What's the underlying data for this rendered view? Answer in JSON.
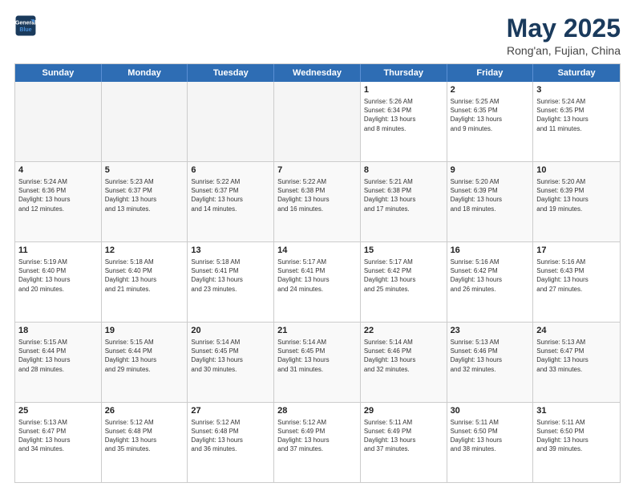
{
  "logo": {
    "line1": "General",
    "line2": "Blue"
  },
  "title": {
    "month": "May 2025",
    "location": "Rong'an, Fujian, China"
  },
  "weekdays": [
    "Sunday",
    "Monday",
    "Tuesday",
    "Wednesday",
    "Thursday",
    "Friday",
    "Saturday"
  ],
  "weeks": [
    [
      {
        "day": "",
        "info": ""
      },
      {
        "day": "",
        "info": ""
      },
      {
        "day": "",
        "info": ""
      },
      {
        "day": "",
        "info": ""
      },
      {
        "day": "1",
        "info": "Sunrise: 5:26 AM\nSunset: 6:34 PM\nDaylight: 13 hours\nand 8 minutes."
      },
      {
        "day": "2",
        "info": "Sunrise: 5:25 AM\nSunset: 6:35 PM\nDaylight: 13 hours\nand 9 minutes."
      },
      {
        "day": "3",
        "info": "Sunrise: 5:24 AM\nSunset: 6:35 PM\nDaylight: 13 hours\nand 11 minutes."
      }
    ],
    [
      {
        "day": "4",
        "info": "Sunrise: 5:24 AM\nSunset: 6:36 PM\nDaylight: 13 hours\nand 12 minutes."
      },
      {
        "day": "5",
        "info": "Sunrise: 5:23 AM\nSunset: 6:37 PM\nDaylight: 13 hours\nand 13 minutes."
      },
      {
        "day": "6",
        "info": "Sunrise: 5:22 AM\nSunset: 6:37 PM\nDaylight: 13 hours\nand 14 minutes."
      },
      {
        "day": "7",
        "info": "Sunrise: 5:22 AM\nSunset: 6:38 PM\nDaylight: 13 hours\nand 16 minutes."
      },
      {
        "day": "8",
        "info": "Sunrise: 5:21 AM\nSunset: 6:38 PM\nDaylight: 13 hours\nand 17 minutes."
      },
      {
        "day": "9",
        "info": "Sunrise: 5:20 AM\nSunset: 6:39 PM\nDaylight: 13 hours\nand 18 minutes."
      },
      {
        "day": "10",
        "info": "Sunrise: 5:20 AM\nSunset: 6:39 PM\nDaylight: 13 hours\nand 19 minutes."
      }
    ],
    [
      {
        "day": "11",
        "info": "Sunrise: 5:19 AM\nSunset: 6:40 PM\nDaylight: 13 hours\nand 20 minutes."
      },
      {
        "day": "12",
        "info": "Sunrise: 5:18 AM\nSunset: 6:40 PM\nDaylight: 13 hours\nand 21 minutes."
      },
      {
        "day": "13",
        "info": "Sunrise: 5:18 AM\nSunset: 6:41 PM\nDaylight: 13 hours\nand 23 minutes."
      },
      {
        "day": "14",
        "info": "Sunrise: 5:17 AM\nSunset: 6:41 PM\nDaylight: 13 hours\nand 24 minutes."
      },
      {
        "day": "15",
        "info": "Sunrise: 5:17 AM\nSunset: 6:42 PM\nDaylight: 13 hours\nand 25 minutes."
      },
      {
        "day": "16",
        "info": "Sunrise: 5:16 AM\nSunset: 6:42 PM\nDaylight: 13 hours\nand 26 minutes."
      },
      {
        "day": "17",
        "info": "Sunrise: 5:16 AM\nSunset: 6:43 PM\nDaylight: 13 hours\nand 27 minutes."
      }
    ],
    [
      {
        "day": "18",
        "info": "Sunrise: 5:15 AM\nSunset: 6:44 PM\nDaylight: 13 hours\nand 28 minutes."
      },
      {
        "day": "19",
        "info": "Sunrise: 5:15 AM\nSunset: 6:44 PM\nDaylight: 13 hours\nand 29 minutes."
      },
      {
        "day": "20",
        "info": "Sunrise: 5:14 AM\nSunset: 6:45 PM\nDaylight: 13 hours\nand 30 minutes."
      },
      {
        "day": "21",
        "info": "Sunrise: 5:14 AM\nSunset: 6:45 PM\nDaylight: 13 hours\nand 31 minutes."
      },
      {
        "day": "22",
        "info": "Sunrise: 5:14 AM\nSunset: 6:46 PM\nDaylight: 13 hours\nand 32 minutes."
      },
      {
        "day": "23",
        "info": "Sunrise: 5:13 AM\nSunset: 6:46 PM\nDaylight: 13 hours\nand 32 minutes."
      },
      {
        "day": "24",
        "info": "Sunrise: 5:13 AM\nSunset: 6:47 PM\nDaylight: 13 hours\nand 33 minutes."
      }
    ],
    [
      {
        "day": "25",
        "info": "Sunrise: 5:13 AM\nSunset: 6:47 PM\nDaylight: 13 hours\nand 34 minutes."
      },
      {
        "day": "26",
        "info": "Sunrise: 5:12 AM\nSunset: 6:48 PM\nDaylight: 13 hours\nand 35 minutes."
      },
      {
        "day": "27",
        "info": "Sunrise: 5:12 AM\nSunset: 6:48 PM\nDaylight: 13 hours\nand 36 minutes."
      },
      {
        "day": "28",
        "info": "Sunrise: 5:12 AM\nSunset: 6:49 PM\nDaylight: 13 hours\nand 37 minutes."
      },
      {
        "day": "29",
        "info": "Sunrise: 5:11 AM\nSunset: 6:49 PM\nDaylight: 13 hours\nand 37 minutes."
      },
      {
        "day": "30",
        "info": "Sunrise: 5:11 AM\nSunset: 6:50 PM\nDaylight: 13 hours\nand 38 minutes."
      },
      {
        "day": "31",
        "info": "Sunrise: 5:11 AM\nSunset: 6:50 PM\nDaylight: 13 hours\nand 39 minutes."
      }
    ]
  ]
}
